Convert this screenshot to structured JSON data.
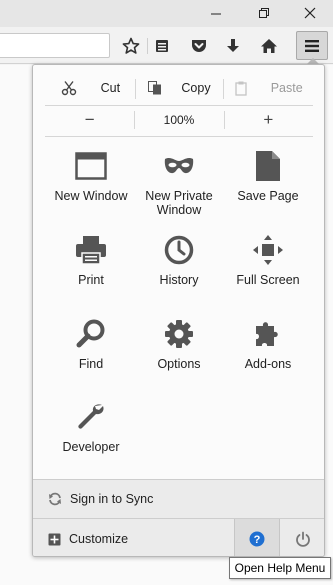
{
  "edit": {
    "cut": "Cut",
    "copy": "Copy",
    "paste": "Paste"
  },
  "zoom": {
    "minus": "−",
    "level": "100%",
    "plus": "+"
  },
  "tiles": [
    {
      "label": "New Window",
      "icon": "window-icon"
    },
    {
      "label": "New Private\nWindow",
      "icon": "mask-icon"
    },
    {
      "label": "Save Page",
      "icon": "page-icon"
    },
    {
      "label": "Print",
      "icon": "printer-icon"
    },
    {
      "label": "History",
      "icon": "clock-icon"
    },
    {
      "label": "Full Screen",
      "icon": "fullscreen-icon"
    },
    {
      "label": "Find",
      "icon": "magnifier-icon"
    },
    {
      "label": "Options",
      "icon": "gear-icon"
    },
    {
      "label": "Add-ons",
      "icon": "puzzle-icon"
    },
    {
      "label": "Developer",
      "icon": "wrench-icon"
    }
  ],
  "sync": {
    "label": "Sign in to Sync"
  },
  "customize": {
    "label": "Customize"
  },
  "tooltip": {
    "text": "Open Help Menu"
  },
  "colors": {
    "help_blue": "#1f6fd1",
    "icon_gray": "#555555"
  }
}
